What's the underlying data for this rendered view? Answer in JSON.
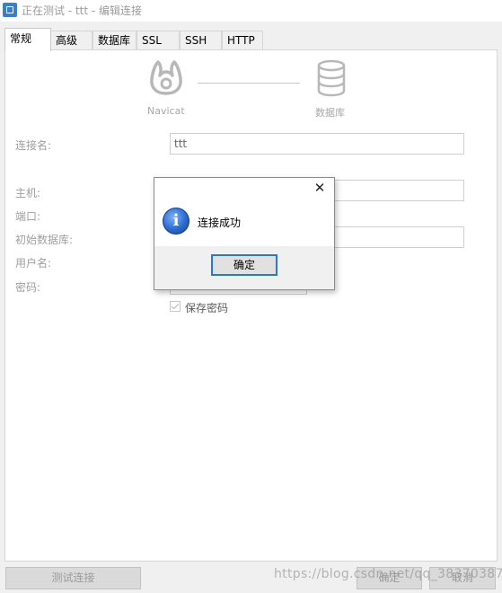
{
  "window": {
    "title": "正在测试 - ttt - 编辑连接"
  },
  "tabs": [
    {
      "label": "常规"
    },
    {
      "label": "高级"
    },
    {
      "label": "数据库"
    },
    {
      "label": "SSL"
    },
    {
      "label": "SSH"
    },
    {
      "label": "HTTP"
    }
  ],
  "header": {
    "navicat_label": "Navicat",
    "db_label": "数据库"
  },
  "form": {
    "conn_name_label": "连接名:",
    "conn_name_value": "ttt",
    "host_label": "主机:",
    "port_label": "端口:",
    "initial_db_label": "初始数据库:",
    "username_label": "用户名:",
    "password_label": "密码:",
    "save_password_label": "保存密码",
    "save_password_checked": true
  },
  "buttons": {
    "test_label": "测试连接",
    "ok_label": "确定",
    "cancel_label": "取消"
  },
  "dialog": {
    "message": "连接成功",
    "ok_label": "确定",
    "icon": "info-icon"
  },
  "watermark": {
    "text": "https://blog.csdn.net/qq_38370387"
  },
  "colors": {
    "accent": "#2c77d1",
    "info_icon": "#2b6ad3"
  }
}
